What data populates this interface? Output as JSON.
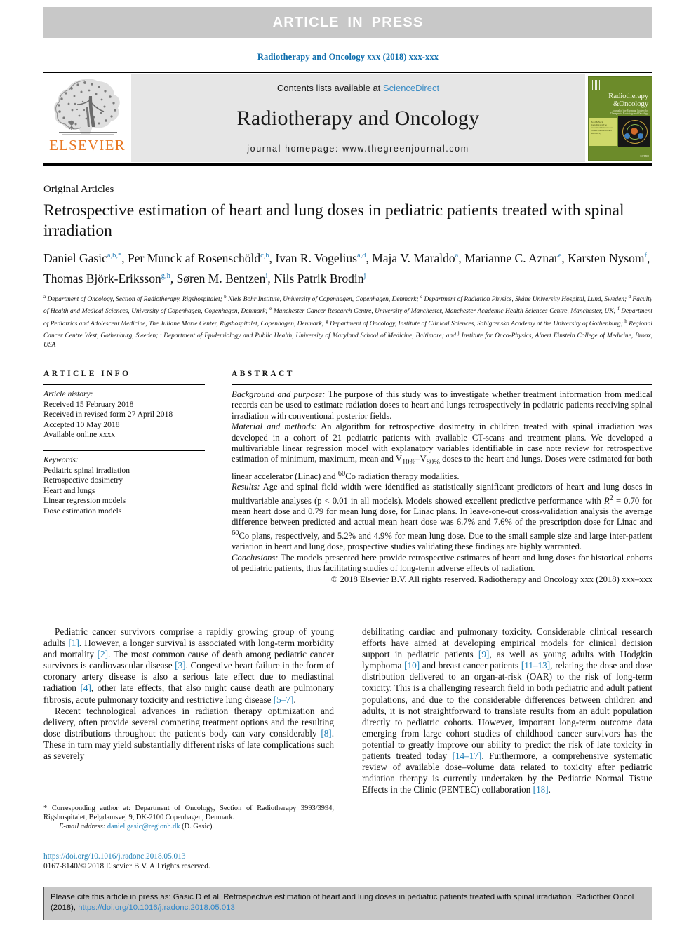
{
  "banner": {
    "text": "ARTICLE IN PRESS",
    "bg_color": "#c8c8c8",
    "text_color": "#ffffff"
  },
  "running_head": {
    "text": "Radiotherapy and Oncology xxx (2018) xxx-xxx",
    "color": "#0f6ead"
  },
  "masthead": {
    "publisher": "ELSEVIER",
    "publisher_color": "#e87722",
    "contents_prefix": "Contents lists available at ",
    "contents_link": "ScienceDirect",
    "journal_title": "Radiotherapy and Oncology",
    "homepage": "journal homepage: www.thegreenjournal.com",
    "cover": {
      "title_line1": "Radiotherapy",
      "title_line2": "&Oncology",
      "subtitle": "Journal of the European Society for\nTherapeutic Radiology and Oncology",
      "side_text": "Head & Neck Radiotherapy\nThe association between dose-volume\nparameters and late toxicity",
      "footer": "ESTRO"
    }
  },
  "article": {
    "section_label": "Original Articles",
    "title": "Retrospective estimation of heart and lung doses in pediatric patients treated with spinal irradiation",
    "authors_line1": "Daniel Gasic",
    "authors": [
      {
        "name": "Daniel Gasic",
        "sup": "a,b,*"
      },
      {
        "name": "Per Munck af Rosenschöld",
        "sup": "c,b"
      },
      {
        "name": "Ivan R. Vogelius",
        "sup": "a,d"
      },
      {
        "name": "Maja V. Maraldo",
        "sup": "a"
      },
      {
        "name": "Marianne C. Aznar",
        "sup": "e"
      },
      {
        "name": "Karsten Nysom",
        "sup": "f"
      },
      {
        "name": "Thomas Björk-Eriksson",
        "sup": "g,h"
      },
      {
        "name": "Søren M. Bentzen",
        "sup": "i"
      },
      {
        "name": "Nils Patrik Brodin",
        "sup": "j"
      }
    ],
    "affiliations": "a Department of Oncology, Section of Radiotherapy, Rigshospitalet; b Niels Bohr Institute, University of Copenhagen, Copenhagen, Denmark; c Department of Radiation Physics, Skåne University Hospital, Lund, Sweden; d Faculty of Health and Medical Sciences, University of Copenhagen, Copenhagen, Denmark; e Manchester Cancer Research Centre, University of Manchester, Manchester Academic Health Sciences Centre, Manchester, UK; f Department of Pediatrics and Adolescent Medicine, The Juliane Marie Center, Rigshospitalet, Copenhagen, Denmark; g Department of Oncology, Institute of Clinical Sciences, Sahlgrenska Academy at the University of Gothenburg; h Regional Cancer Centre West, Gothenburg, Sweden; i Department of Epidemiology and Public Health, University of Maryland School of Medicine, Baltimore; and j Institute for Onco-Physics, Albert Einstein College of Medicine, Bronx, USA"
  },
  "article_info": {
    "heading": "ARTICLE INFO",
    "history_label": "Article history:",
    "history": [
      "Received 15 February 2018",
      "Received in revised form 27 April 2018",
      "Accepted 10 May 2018",
      "Available online xxxx"
    ],
    "keywords_label": "Keywords:",
    "keywords": [
      "Pediatric spinal irradiation",
      "Retrospective dosimetry",
      "Heart and lungs",
      "Linear regression models",
      "Dose estimation models"
    ]
  },
  "abstract": {
    "heading": "ABSTRACT",
    "background_label": "Background and purpose:",
    "background_text": " The purpose of this study was to investigate whether treatment information from medical records can be used to estimate radiation doses to heart and lungs retrospectively in pediatric patients receiving spinal irradiation with conventional posterior fields.",
    "methods_label": "Material and methods:",
    "methods_text": " An algorithm for retrospective dosimetry in children treated with spinal irradiation was developed in a cohort of 21 pediatric patients with available CT-scans and treatment plans. We developed a multivariable linear regression model with explanatory variables identifiable in case note review for retrospective estimation of minimum, maximum, mean and V10%–V80% doses to the heart and lungs. Doses were estimated for both linear accelerator (Linac) and 60Co radiation therapy modalities.",
    "results_label": "Results:",
    "results_text": " Age and spinal field width were identified as statistically significant predictors of heart and lung doses in multivariable analyses (p < 0.01 in all models). Models showed excellent predictive performance with R2 = 0.70 for mean heart dose and 0.79 for mean lung dose, for Linac plans. In leave-one-out cross-validation analysis the average difference between predicted and actual mean heart dose was 6.7% and 7.6% of the prescription dose for Linac and 60Co plans, respectively, and 5.2% and 4.9% for mean lung dose. Due to the small sample size and large inter-patient variation in heart and lung dose, prospective studies validating these findings are highly warranted.",
    "conclusions_label": "Conclusions:",
    "conclusions_text": " The models presented here provide retrospective estimates of heart and lung doses for historical cohorts of pediatric patients, thus facilitating studies of long-term adverse effects of radiation.",
    "copyright": "© 2018 Elsevier B.V. All rights reserved. Radiotherapy and Oncology xxx (2018) xxx–xxx"
  },
  "body": {
    "left_paragraph_1": "Pediatric cancer survivors comprise a rapidly growing group of young adults [1]. However, a longer survival is associated with long-term morbidity and mortality [2]. The most common cause of death among pediatric cancer survivors is cardiovascular disease [3]. Congestive heart failure in the form of coronary artery disease is also a serious late effect due to mediastinal radiation [4], other late effects, that also might cause death are pulmonary fibrosis, acute pulmonary toxicity and restrictive lung disease [5–7].",
    "left_paragraph_2": "Recent technological advances in radiation therapy optimization and delivery, often provide several competing treatment options and the resulting dose distributions throughout the patient's body can vary considerably [8]. These in turn may yield substantially different risks of late complications such as severely",
    "right_paragraph_1": "debilitating cardiac and pulmonary toxicity. Considerable clinical research efforts have aimed at developing empirical models for clinical decision support in pediatric patients [9], as well as young adults with Hodgkin lymphoma [10] and breast cancer patients [11–13], relating the dose and dose distribution delivered to an organ-at-risk (OAR) to the risk of long-term toxicity. This is a challenging research field in both pediatric and adult patient populations, and due to the considerable differences between children and adults, it is not straightforward to translate results from an adult population directly to pediatric cohorts. However, important long-term outcome data emerging from large cohort studies of childhood cancer survivors has the potential to greatly improve our ability to predict the risk of late toxicity in patients treated today [14–17]. Furthermore, a comprehensive systematic review of available dose–volume data related to toxicity after pediatric radiation therapy is currently undertaken by the Pediatric Normal Tissue Effects in the Clinic (PENTEC) collaboration [18]."
  },
  "footnote": {
    "marker": "*",
    "corresponding": "Corresponding author at: Department of Oncology, Section of Radiotherapy 3993/3994, Rigshospitalet, Belgdamsvej 9, DK-2100 Copenhagen, Denmark.",
    "email_label": "E-mail address:",
    "email": "daniel.gasic@regionh.dk",
    "email_owner": "(D. Gasic).",
    "doi": "https://doi.org/10.1016/j.radonc.2018.05.013",
    "issn_line": "0167-8140/© 2018 Elsevier B.V. All rights reserved."
  },
  "cite_box": {
    "text": "Please cite this article in press as: Gasic D et al. Retrospective estimation of heart and lung doses in pediatric patients treated with spinal irradiation. Radiother Oncol (2018), ",
    "link": "https://doi.org/10.1016/j.radonc.2018.05.013",
    "bg_color": "#c8c8c8",
    "link_color": "#2f86c8"
  }
}
